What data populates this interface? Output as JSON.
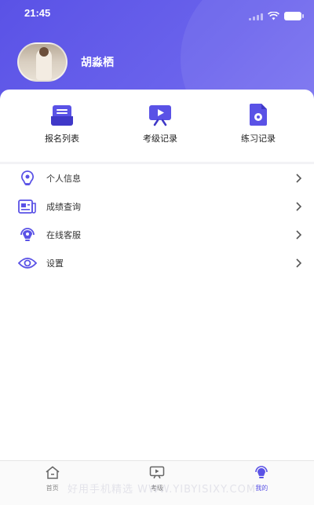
{
  "status_bar": {
    "time": "21:45"
  },
  "profile": {
    "name": "胡淼栖"
  },
  "quick_actions": [
    {
      "label": "报名列表",
      "icon": "registration-list-icon"
    },
    {
      "label": "考级记录",
      "icon": "exam-record-icon"
    },
    {
      "label": "练习记录",
      "icon": "practice-record-icon"
    }
  ],
  "menu": [
    {
      "label": "个人信息",
      "icon": "personal-info-icon"
    },
    {
      "label": "成绩查询",
      "icon": "score-query-icon"
    },
    {
      "label": "在线客服",
      "icon": "customer-service-icon"
    },
    {
      "label": "设置",
      "icon": "settings-eye-icon"
    }
  ],
  "tabbar": [
    {
      "label": "首页",
      "icon": "home-icon"
    },
    {
      "label": "考级",
      "icon": "exam-icon"
    },
    {
      "label": "我的",
      "icon": "me-icon",
      "active": true
    }
  ],
  "watermark": "好用手机精选 WWW.YIBYISIXY.COM",
  "colors": {
    "accent": "#5a52e6",
    "text": "#333333",
    "tab_inactive": "#888888"
  }
}
